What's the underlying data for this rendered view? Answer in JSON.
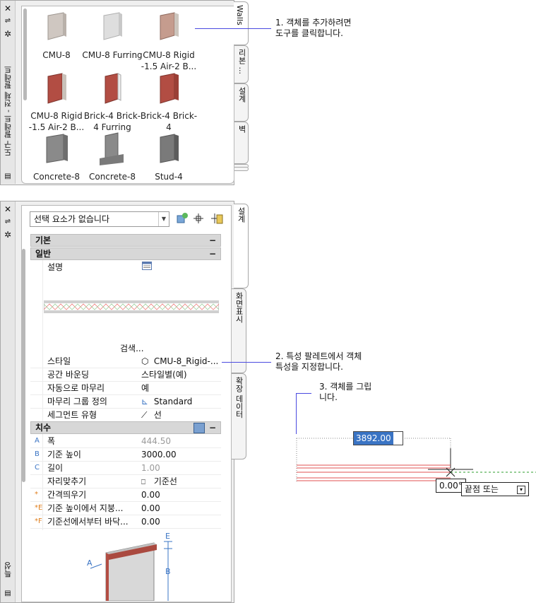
{
  "tool_palette": {
    "strip_title": "도구 팔레트 - 전체 팔레트",
    "tabs": [
      "Walls",
      "리본 ...",
      "설계",
      "벽"
    ],
    "tools": [
      {
        "label": "CMU-8",
        "icon": "cmu-wall-icon"
      },
      {
        "label": "CMU-8 Furring",
        "icon": "cmu-furring-wall-icon"
      },
      {
        "label": "CMU-8 Rigid -1.5 Air-2 B...",
        "icon": "cmu-rigid-wall-icon"
      },
      {
        "label": "CMU-8 Rigid -1.5 Air-2 B...",
        "icon": "cmu-rigid-brick-wall-icon"
      },
      {
        "label": "Brick-4 Brick-4 Furring",
        "icon": "brick-furring-wall-icon"
      },
      {
        "label": "Brick-4 Brick-4",
        "icon": "brick-wall-icon"
      },
      {
        "label": "Concrete-8",
        "icon": "concrete-wall-icon"
      },
      {
        "label": "Concrete-8",
        "icon": "concrete-footing-wall-icon"
      },
      {
        "label": "Stud-4",
        "icon": "stud-wall-icon"
      }
    ]
  },
  "properties": {
    "strip_title": "특성",
    "select_value": "선택 요소가 없습니다",
    "tabs": [
      "설계",
      "화면표시",
      "확장 데이터"
    ],
    "sections": {
      "basic": "기본",
      "general": "일반",
      "dimensions": "치수"
    },
    "description_label": "설명",
    "browse_label": "검색...",
    "general_rows": [
      {
        "label": "스타일",
        "value": "CMU-8_Rigid-..."
      },
      {
        "label": "공간 바운딩",
        "value": "스타일별(예)"
      },
      {
        "label": "자동으로 마무리",
        "value": "예"
      },
      {
        "label": "마무리 그룹 정의",
        "value": "Standard"
      },
      {
        "label": "세그먼트 유형",
        "value": "선"
      }
    ],
    "dimension_rows": [
      {
        "marker": "A",
        "label": "폭",
        "value": "444.50",
        "gray": true
      },
      {
        "marker": "B",
        "label": "기준 높이",
        "value": "3000.00",
        "gray": false
      },
      {
        "marker": "C",
        "label": "길이",
        "value": "1.00",
        "gray": true
      },
      {
        "marker": "",
        "label": "자리맞추기",
        "value": "기준선",
        "gray": false
      },
      {
        "marker": "*",
        "label": "간격띄우기",
        "value": "0.00",
        "gray": false
      },
      {
        "marker": "*E",
        "label": "기준 높이에서 지붕...",
        "value": "0.00",
        "gray": false
      },
      {
        "marker": "*F",
        "label": "기준선에서부터 바닥...",
        "value": "0.00",
        "gray": false
      }
    ],
    "diagram_letters": [
      "E",
      "A",
      "B"
    ]
  },
  "callouts": {
    "step1": [
      "1. 객체를 추가하려면",
      "도구를 클릭합니다."
    ],
    "step2": [
      "2. 특성 팔레트에서 객체",
      "특성을 지정합니다."
    ],
    "step3": [
      "3. 객체를 그립",
      "니다."
    ]
  },
  "drawing": {
    "length_input": "3892.00",
    "angle_input": "0.00°",
    "prompt": "끝점 또는"
  },
  "colors": {
    "accent_blue": "#4a4ae0",
    "wall_red": "#e05050",
    "dashed_green": "#2e9e2e",
    "brick": "#b24d43"
  }
}
